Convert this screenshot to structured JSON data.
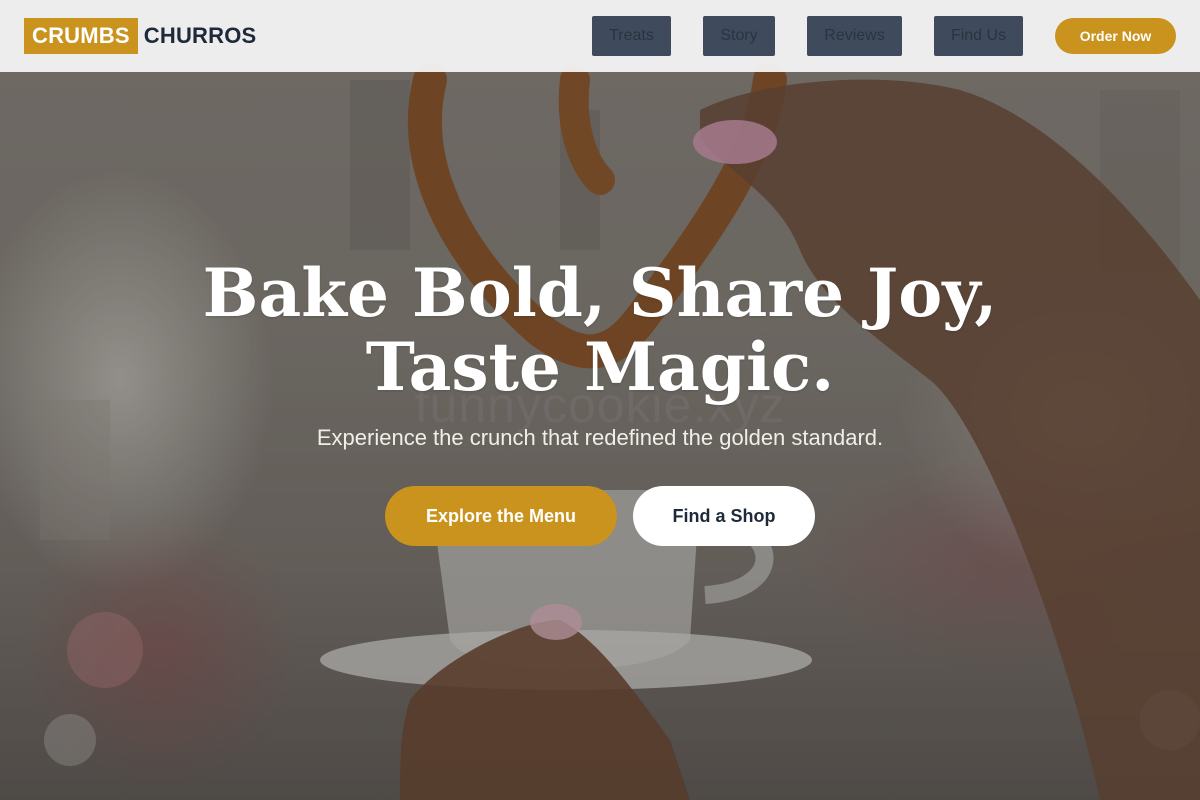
{
  "brand": {
    "highlight": "CRUMBS",
    "name": "CHURROS"
  },
  "nav": {
    "links": [
      {
        "label": "Treats"
      },
      {
        "label": "Story"
      },
      {
        "label": "Reviews"
      },
      {
        "label": "Find Us"
      }
    ],
    "cta_label": "Order Now"
  },
  "hero": {
    "headline_line1": "Bake Bold, Share Joy,",
    "headline_line2": "Taste Magic.",
    "watermark": "funnycookie.xyz",
    "subtitle": "Experience the crunch that redefined the golden standard.",
    "primary_cta": "Explore the Menu",
    "secondary_cta": "Find a Shop"
  },
  "colors": {
    "accent": "#c9931d",
    "nav_button": "#3f4a5c",
    "brand_text": "#1e2a3a"
  }
}
